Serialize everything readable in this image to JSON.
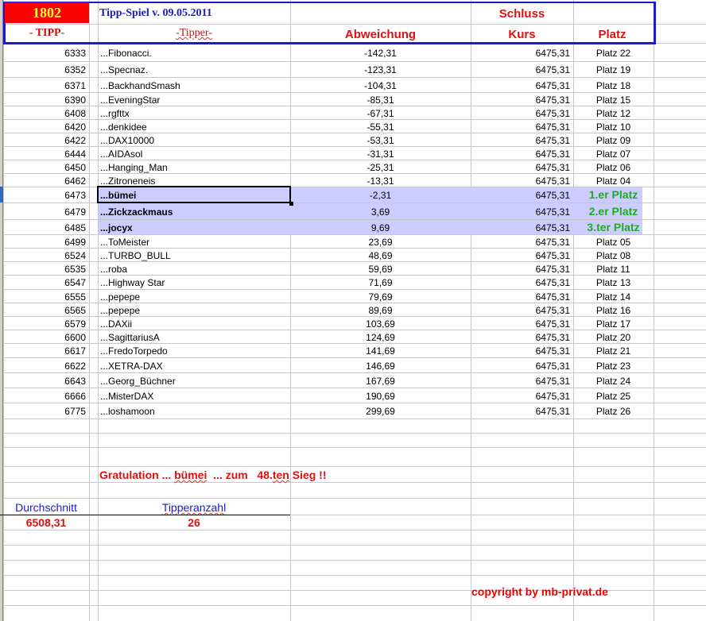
{
  "header": {
    "tipp_number": "1802",
    "title": "Tipp-Spiel v. 09.05.2011",
    "col_tipp": "- TIPP-",
    "col_tipper": "-Tipper-",
    "col_abweichung": "Abweichung",
    "col_schluss": "Schluss",
    "col_kurs": "Kurs",
    "col_platz": "Platz"
  },
  "rows": [
    {
      "tipp": "6333",
      "name": "...Fibonacci.",
      "abw": "-142,31",
      "kurs": "6475,31",
      "platz": "Platz 22",
      "top": false
    },
    {
      "tipp": "6352",
      "name": "...Specnaz.",
      "abw": "-123,31",
      "kurs": "6475,31",
      "platz": "Platz 19",
      "top": false
    },
    {
      "tipp": "6371",
      "name": "...BackhandSmash",
      "abw": "-104,31",
      "kurs": "6475,31",
      "platz": "Platz 18",
      "top": false
    },
    {
      "tipp": "6390",
      "name": "...EveningStar",
      "abw": "-85,31",
      "kurs": "6475,31",
      "platz": "Platz 15",
      "top": false
    },
    {
      "tipp": "6408",
      "name": "...rgfttx",
      "abw": "-67,31",
      "kurs": "6475,31",
      "platz": "Platz 12",
      "top": false
    },
    {
      "tipp": "6420",
      "name": "...denkidee",
      "abw": "-55,31",
      "kurs": "6475,31",
      "platz": "Platz 10",
      "top": false
    },
    {
      "tipp": "6422",
      "name": "...DAX10000",
      "abw": "-53,31",
      "kurs": "6475,31",
      "platz": "Platz 09",
      "top": false
    },
    {
      "tipp": "6444",
      "name": "...AIDAsol",
      "abw": "-31,31",
      "kurs": "6475,31",
      "platz": "Platz 07",
      "top": false
    },
    {
      "tipp": "6450",
      "name": "...Hanging_Man",
      "abw": "-25,31",
      "kurs": "6475,31",
      "platz": "Platz 06",
      "top": false
    },
    {
      "tipp": "6462",
      "name": "...Zitroneneis",
      "abw": "-13,31",
      "kurs": "6475,31",
      "platz": "Platz 04",
      "top": false
    },
    {
      "tipp": "6473",
      "name": "...bümei",
      "abw": "-2,31",
      "kurs": "6475,31",
      "platz": "1.er Platz",
      "top": true
    },
    {
      "tipp": "6479",
      "name": "...Zickzackmaus",
      "abw": "3,69",
      "kurs": "6475,31",
      "platz": "2.er Platz",
      "top": true
    },
    {
      "tipp": "6485",
      "name": "...jocyx",
      "abw": "9,69",
      "kurs": "6475,31",
      "platz": "3.ter Platz",
      "top": true
    },
    {
      "tipp": "6499",
      "name": "...ToMeister",
      "abw": "23,69",
      "kurs": "6475,31",
      "platz": "Platz 05",
      "top": false
    },
    {
      "tipp": "6524",
      "name": "...TURBO_BULL",
      "abw": "48,69",
      "kurs": "6475,31",
      "platz": "Platz 08",
      "top": false
    },
    {
      "tipp": "6535",
      "name": "...roba",
      "abw": "59,69",
      "kurs": "6475,31",
      "platz": "Platz 11",
      "top": false
    },
    {
      "tipp": "6547",
      "name": "...Highway Star",
      "abw": "71,69",
      "kurs": "6475,31",
      "platz": "Platz 13",
      "top": false
    },
    {
      "tipp": "6555",
      "name": "...pepepe",
      "abw": "79,69",
      "kurs": "6475,31",
      "platz": "Platz 14",
      "top": false
    },
    {
      "tipp": "6565",
      "name": "...pepepe",
      "abw": "89,69",
      "kurs": "6475,31",
      "platz": "Platz 16",
      "top": false
    },
    {
      "tipp": "6579",
      "name": "...DAXii",
      "abw": "103,69",
      "kurs": "6475,31",
      "platz": "Platz 17",
      "top": false
    },
    {
      "tipp": "6600",
      "name": "...SagittariusA",
      "abw": "124,69",
      "kurs": "6475,31",
      "platz": "Platz 20",
      "top": false
    },
    {
      "tipp": "6617",
      "name": "...FredoTorpedo",
      "abw": "141,69",
      "kurs": "6475,31",
      "platz": "Platz 21",
      "top": false
    },
    {
      "tipp": "6622",
      "name": "...XETRA-DAX",
      "abw": "146,69",
      "kurs": "6475,31",
      "platz": "Platz 23",
      "top": false
    },
    {
      "tipp": "6643",
      "name": "...Georg_Büchner",
      "abw": "167,69",
      "kurs": "6475,31",
      "platz": "Platz 24",
      "top": false
    },
    {
      "tipp": "6666",
      "name": "...MisterDAX",
      "abw": "190,69",
      "kurs": "6475,31",
      "platz": "Platz 25",
      "top": false
    },
    {
      "tipp": "6775",
      "name": "...loshamoon",
      "abw": "299,69",
      "kurs": "6475,31",
      "platz": "Platz 26",
      "top": false
    }
  ],
  "footer": {
    "gratulation": "Gratulation ... ",
    "winner": "bümei",
    "zum": "  ... zum   48.",
    "ten": "ten",
    "sieg": " Sieg !!",
    "durchschnitt_label": "Durchschnitt",
    "durchschnitt_value": "6508,31",
    "tipperanzahl_label": "Tipperanzahl",
    "tipperanzahl_value": "26",
    "copyright": "copyright by mb-privat.de"
  },
  "colors": {
    "highlight": "#ccccff",
    "header_border": "#1a1acc",
    "red": "#dd1111",
    "green": "#22aa22"
  }
}
